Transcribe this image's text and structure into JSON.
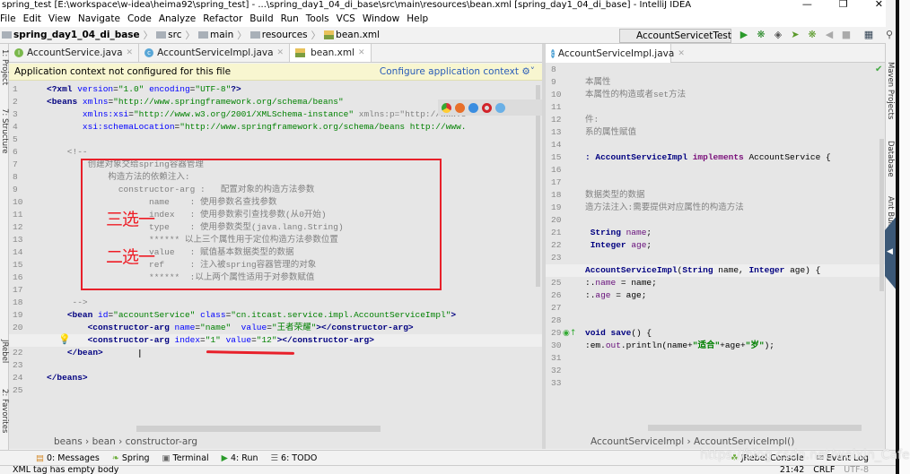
{
  "window": {
    "title": "spring_test [E:\\workspace\\w-idea\\heima92\\spring_test] - ...\\spring_day1_04_di_base\\src\\main\\resources\\bean.xml [spring_day1_04_di_base] - IntelliJ IDEA"
  },
  "menu": [
    "File",
    "Edit",
    "View",
    "Navigate",
    "Code",
    "Analyze",
    "Refactor",
    "Build",
    "Run",
    "Tools",
    "VCS",
    "Window",
    "Help"
  ],
  "navbar": {
    "crumbs": [
      "spring_day1_04_di_base",
      "src",
      "main",
      "resources",
      "bean.xml"
    ],
    "run_config": "AccountServicetTest"
  },
  "left_tabs": [
    {
      "label": "AccountService.java",
      "icon": "interface-icon"
    },
    {
      "label": "AccountServiceImpl.java",
      "icon": "class-icon"
    },
    {
      "label": "bean.xml",
      "icon": "xml-icon",
      "active": true
    }
  ],
  "banner": {
    "message": "Application context not configured for this file",
    "action": "Configure application context"
  },
  "left_code": [
    [
      [
        "tag",
        "<?xml "
      ],
      [
        "attr",
        "version"
      ],
      [
        "plain",
        "="
      ],
      [
        "strv",
        "\"1.0\""
      ],
      [
        "plain",
        " "
      ],
      [
        "attr",
        "encoding"
      ],
      [
        "plain",
        "="
      ],
      [
        "strv",
        "\"UTF-8\""
      ],
      [
        "tag",
        "?>"
      ]
    ],
    [
      [
        "tag",
        "<beans "
      ],
      [
        "attr",
        "xmlns"
      ],
      [
        "plain",
        "="
      ],
      [
        "strv",
        "\"http://www.springframework.org/schema/beans\""
      ]
    ],
    [
      [
        "plain",
        "       "
      ],
      [
        "attr",
        "xmlns:xsi"
      ],
      [
        "plain",
        "="
      ],
      [
        "strv",
        "\"http://www.w3.org/2001/XMLSchema-instance\""
      ],
      [
        "cmt",
        " xmlns:p=\"http://www.s"
      ]
    ],
    [
      [
        "plain",
        "       "
      ],
      [
        "attr",
        "xsi:schemaLocation"
      ],
      [
        "plain",
        "="
      ],
      [
        "strv",
        "\"http://www.springframework.org/schema/beans http://www."
      ]
    ],
    [],
    [
      [
        "cmt",
        "    <!--"
      ]
    ],
    [
      [
        "cmt",
        "        创建对象交给spring容器管理"
      ]
    ],
    [
      [
        "cmt",
        "            构造方法的依赖注入:"
      ]
    ],
    [
      [
        "cmt",
        "              constructor-arg :   配置对象的构造方法参数"
      ]
    ],
    [
      [
        "cmt",
        "                    name    : 使用参数名查找参数"
      ]
    ],
    [
      [
        "cmt",
        "                    index   : 使用参数索引查找参数(从0开始)"
      ]
    ],
    [
      [
        "cmt",
        "                    type    : 使用参数类型(java.lang.String)"
      ]
    ],
    [
      [
        "cmt",
        "                    ****** 以上三个属性用于定位构造方法参数位置"
      ]
    ],
    [
      [
        "cmt",
        "                    value   : 赋值基本数据类型的数据"
      ]
    ],
    [
      [
        "cmt",
        "                    ref     : 注入被spring容器管理的对象"
      ]
    ],
    [
      [
        "cmt",
        "                    ******  :以上两个属性适用于对参数赋值"
      ]
    ],
    [],
    [
      [
        "cmt",
        "     -->"
      ]
    ],
    [
      [
        "plain",
        "    "
      ],
      [
        "tag",
        "<bean "
      ],
      [
        "attr",
        "id"
      ],
      [
        "plain",
        "="
      ],
      [
        "strv",
        "\"accountService\""
      ],
      [
        "plain",
        " "
      ],
      [
        "attr",
        "class"
      ],
      [
        "plain",
        "="
      ],
      [
        "strv",
        "\"cn.itcast.service.impl.AccountServiceImpl\""
      ],
      [
        "tag",
        ">"
      ]
    ],
    [
      [
        "plain",
        "        "
      ],
      [
        "tag",
        "<constructor-arg "
      ],
      [
        "attr",
        "name"
      ],
      [
        "plain",
        "="
      ],
      [
        "strv",
        "\"name\""
      ],
      [
        "plain",
        "  "
      ],
      [
        "attr",
        "value"
      ],
      [
        "plain",
        "="
      ],
      [
        "strv",
        "\"王者荣耀\""
      ],
      [
        "tag",
        "></constructor-arg>"
      ]
    ],
    [
      [
        "plain",
        "        "
      ],
      [
        "tag",
        "<constructor-arg "
      ],
      [
        "attr",
        "index"
      ],
      [
        "plain",
        "="
      ],
      [
        "strv",
        "\"1\""
      ],
      [
        "plain",
        " "
      ],
      [
        "attr",
        "value"
      ],
      [
        "plain",
        "="
      ],
      [
        "strv",
        "\"12\""
      ],
      [
        "tag",
        "></constructor-arg>"
      ]
    ],
    [
      [
        "plain",
        "    "
      ],
      [
        "tag",
        "</bean>"
      ]
    ],
    [],
    [
      [
        "tag",
        "</beans>"
      ]
    ],
    []
  ],
  "annotations": {
    "three_choose_one": "三选一",
    "two_choose_one": "二选一"
  },
  "left_breadcrumb": [
    "beans",
    "bean",
    "constructor-arg"
  ],
  "right_tab": {
    "label": "AccountServiceImpl.java"
  },
  "right_code_start": 8,
  "right_code": [
    [],
    [
      [
        "cmt",
        "本属性"
      ]
    ],
    [
      [
        "cmt",
        "本属性的构造或者set方法"
      ]
    ],
    [],
    [
      [
        "cmt",
        "件:"
      ]
    ],
    [
      [
        "cmt",
        "系的属性赋值"
      ]
    ],
    [],
    [
      [
        "kw",
        ": AccountServiceImpl "
      ],
      [
        "kw2",
        "implements "
      ],
      [
        "plain",
        "AccountService {"
      ]
    ],
    [],
    [],
    [
      [
        "cmt",
        "数据类型的数据"
      ]
    ],
    [
      [
        "cmt",
        "造方法注入:需要提供对应属性的构造方法"
      ]
    ],
    [],
    [
      [
        "kw",
        " String "
      ],
      [
        "fld",
        "name"
      ],
      [
        "plain",
        ";"
      ]
    ],
    [
      [
        "kw",
        " Integer "
      ],
      [
        "fld",
        "age"
      ],
      [
        "plain",
        ";"
      ]
    ],
    [],
    [
      [
        "kw",
        "AccountServiceImpl"
      ],
      [
        "plain",
        "("
      ],
      [
        "kw",
        "String "
      ],
      [
        "plain",
        "name, "
      ],
      [
        "kw",
        "Integer "
      ],
      [
        "plain",
        "age) {"
      ]
    ],
    [
      [
        "plain",
        ":."
      ],
      [
        "fld",
        "name"
      ],
      [
        "plain",
        " = name;"
      ]
    ],
    [
      [
        "plain",
        ":."
      ],
      [
        "fld",
        "age"
      ],
      [
        "plain",
        " = age;"
      ]
    ],
    [],
    [],
    [
      [
        "kw",
        "void save"
      ],
      [
        "plain",
        "() {"
      ]
    ],
    [
      [
        "plain",
        ":em."
      ],
      [
        "fld",
        "out"
      ],
      [
        "plain",
        ".println(name+"
      ],
      [
        "str",
        "\"适合\""
      ],
      [
        "plain",
        "+age+"
      ],
      [
        "str",
        "\"岁\""
      ],
      [
        "plain",
        ");"
      ]
    ],
    [],
    [],
    []
  ],
  "right_breadcrumb": [
    "AccountServiceImpl",
    "AccountServiceImpl()"
  ],
  "tool_windows_left": [
    "1: Project",
    "7: Structure",
    "JRebel",
    "2: Favorites"
  ],
  "tool_windows_right": [
    "Maven Projects",
    "Database",
    "Ant Build"
  ],
  "bottom_tools": [
    {
      "label": "0: Messages",
      "icon": "messages-icon"
    },
    {
      "label": "Spring",
      "icon": "spring-icon"
    },
    {
      "label": "Terminal",
      "icon": "terminal-icon"
    },
    {
      "label": "4: Run",
      "icon": "run-icon"
    },
    {
      "label": "6: TODO",
      "icon": "todo-icon"
    },
    {
      "label": "JRebel Console",
      "icon": "jrebel-icon"
    },
    {
      "label": "Event Log",
      "icon": "event-log-icon"
    }
  ],
  "status": {
    "message": "XML tag has empty body",
    "position": "21:42",
    "line_sep": "CRLF",
    "encoding": "UTF-8"
  },
  "watermark": "https://blog.csdn.net/weixin_Cafe",
  "colors": {
    "annotation_red": "#e8202a",
    "link": "#2a5cb8",
    "banner": "#f8f6d0"
  }
}
